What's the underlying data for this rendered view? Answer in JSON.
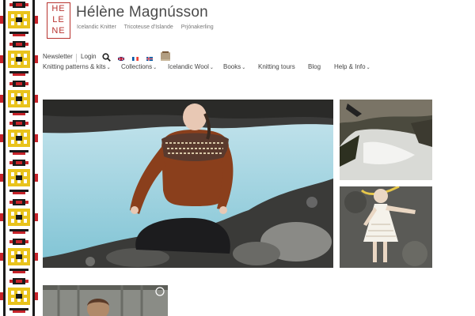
{
  "header": {
    "logo_lines": [
      "HE",
      "LE",
      "NE"
    ],
    "site_title": "Hélène Magnússon",
    "taglines": [
      "Icelandic Knitter",
      "Tricoteuse d'Islande",
      "Prjónakerling"
    ]
  },
  "topbar": {
    "newsletter": "Newsletter",
    "login": "Login",
    "icons": [
      "search-icon",
      "flag-uk-icon",
      "flag-france-icon",
      "flag-iceland-icon",
      "wool-icon"
    ]
  },
  "nav": {
    "items": [
      {
        "label": "Knitting patterns & kits",
        "has_dropdown": true
      },
      {
        "label": "Collections",
        "has_dropdown": true
      },
      {
        "label": "Icelandic Wool",
        "has_dropdown": true
      },
      {
        "label": "Books",
        "has_dropdown": true
      },
      {
        "label": "Knitting tours",
        "has_dropdown": false
      },
      {
        "label": "Blog",
        "has_dropdown": false
      },
      {
        "label": "Help & Info",
        "has_dropdown": true
      }
    ],
    "caret": "⌄"
  },
  "colors": {
    "brand_red": "#b8322e",
    "border_yellow": "#e9c31c",
    "border_red": "#c7242a",
    "border_black": "#1a1a1a"
  }
}
